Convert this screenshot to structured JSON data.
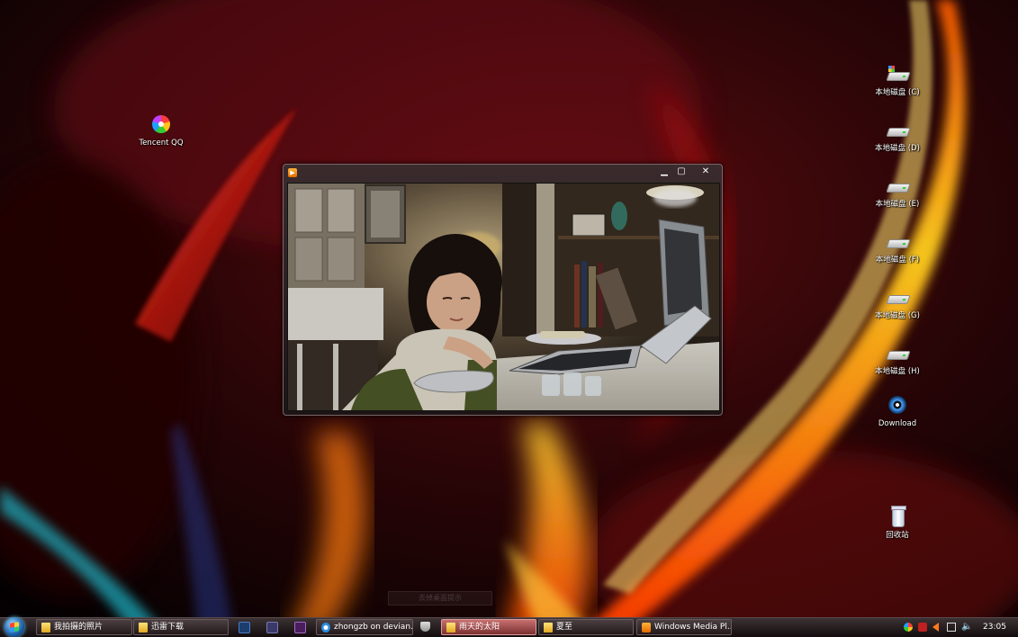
{
  "desktop": {
    "icons": [
      {
        "id": "qq",
        "label": "Tencent QQ",
        "icon": "tencent-qq-icon"
      },
      {
        "id": "c",
        "label": "本地磁盘 (C)",
        "icon": "system-drive-icon"
      },
      {
        "id": "d",
        "label": "本地磁盘 (D)",
        "icon": "hard-drive-icon"
      },
      {
        "id": "e",
        "label": "本地磁盘 (E)",
        "icon": "hard-drive-icon"
      },
      {
        "id": "f",
        "label": "本地磁盘 (F)",
        "icon": "hard-drive-icon"
      },
      {
        "id": "g",
        "label": "本地磁盘 (G)",
        "icon": "hard-drive-icon"
      },
      {
        "id": "h",
        "label": "本地磁盘 (H)",
        "icon": "hard-drive-icon"
      },
      {
        "id": "download",
        "label": "Download",
        "icon": "disc-folder-icon"
      },
      {
        "id": "bin",
        "label": "回收站",
        "icon": "recycle-bin-icon"
      }
    ],
    "faint_tip": "去掉桌面提示"
  },
  "player": {
    "app_icon": "windows-media-player-icon",
    "minimize": "▁",
    "maximize": "▢",
    "close": "✕"
  },
  "taskbar": {
    "start_icon": "windows-start-orb",
    "windows": [
      {
        "label": "我拍摄的照片",
        "icon": "folder-icon",
        "active": false
      },
      {
        "label": "迅雷下载",
        "icon": "folder-icon",
        "active": false
      },
      {
        "label": "zhongzb on devian...",
        "icon": "internet-explorer-icon",
        "active": false
      },
      {
        "label": "雨天的太阳",
        "icon": "folder-icon",
        "active": true
      },
      {
        "label": "夏至",
        "icon": "folder-icon",
        "active": false
      },
      {
        "label": "Windows Media Pl...",
        "icon": "windows-media-player-icon",
        "active": false
      }
    ],
    "quick_launch": [
      "photoshop-icon",
      "window-switch-icon",
      "premiere-icon",
      "security-shield-icon"
    ],
    "tray": {
      "icons": [
        "qq-tray-icon",
        "antivirus-tray-icon",
        "arrow-tray-icon",
        "network-icon",
        "volume-icon"
      ],
      "clock": "23:05"
    }
  },
  "colors": {
    "active_task": "#a85050",
    "wallpaper_base": "#2a0608",
    "flame": "#ffb000"
  }
}
